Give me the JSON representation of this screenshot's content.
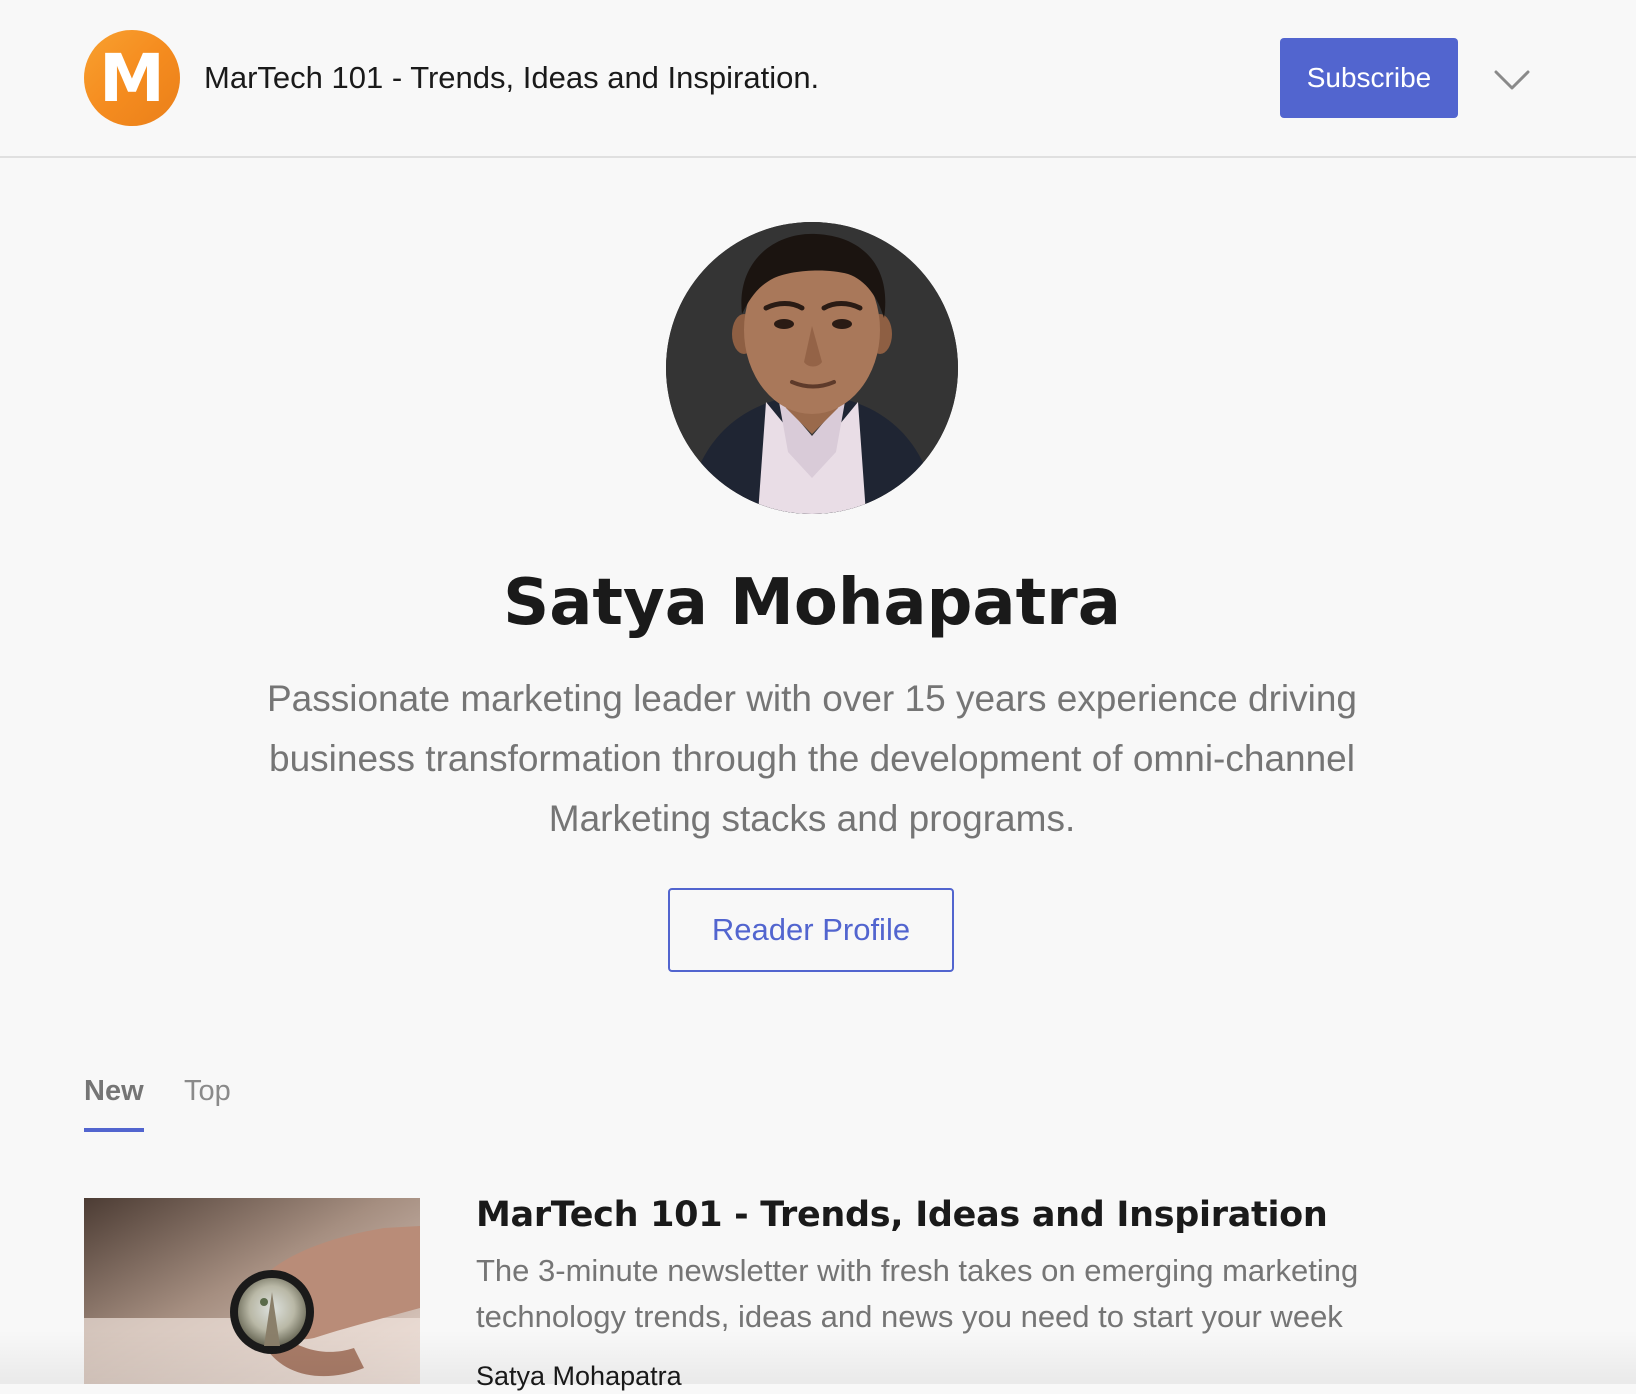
{
  "header": {
    "logo_letter": "M",
    "site_title": "MarTech 101 - Trends, Ideas and Inspiration.",
    "subscribe_label": "Subscribe",
    "menu_icon": "chevron-down-icon",
    "brand_color": "#f58c1f",
    "accent_color": "#5265cf"
  },
  "profile": {
    "name": "Satya Mohapatra",
    "bio": "Passionate marketing leader with over 15 years experience driving business transformation through the development of omni-channel Marketing stacks and programs.",
    "reader_profile_label": "Reader Profile"
  },
  "tabs": [
    {
      "label": "New",
      "active": true
    },
    {
      "label": "Top",
      "active": false
    }
  ],
  "posts": [
    {
      "title": "MarTech 101 - Trends, Ideas and Inspiration",
      "description": "The 3-minute newsletter with fresh takes on emerging marketing technology trends, ideas and news you need to start your week",
      "author": "Satya Mohapatra"
    }
  ]
}
